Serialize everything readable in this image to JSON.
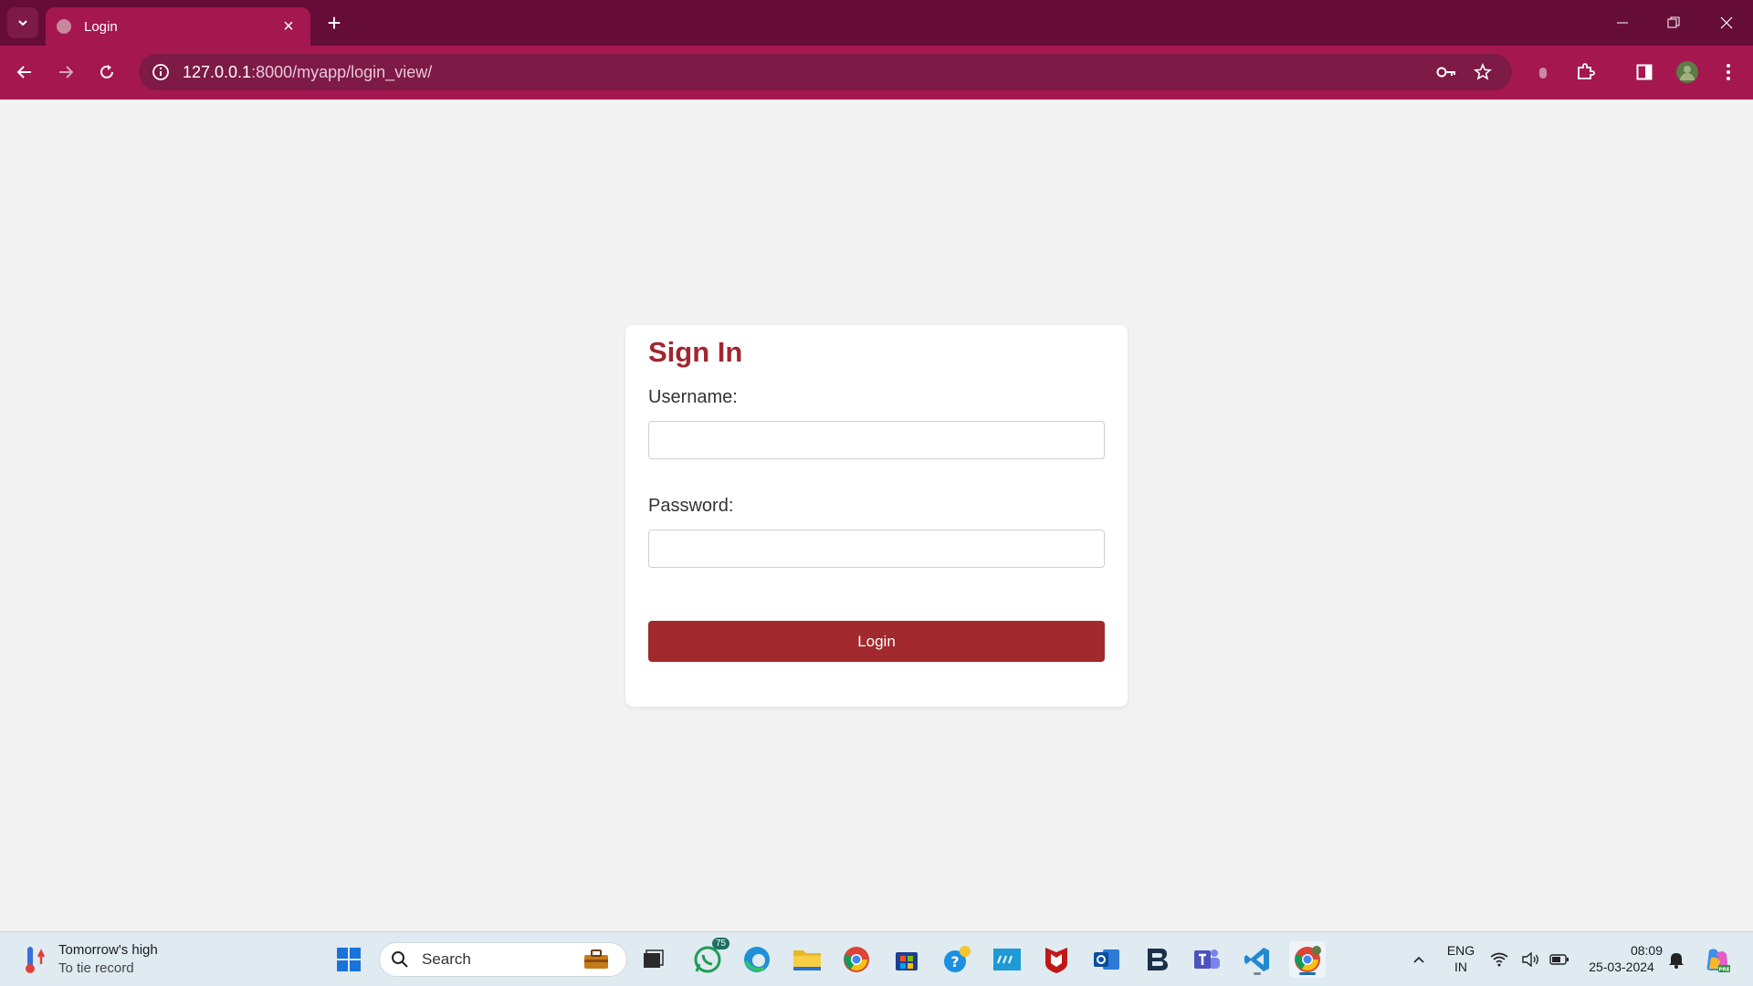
{
  "browser": {
    "tab_title": "Login",
    "url_host": "127.0.0.1",
    "url_path": ":8000/myapp/login_view/"
  },
  "login": {
    "heading": "Sign In",
    "username_label": "Username:",
    "username_value": "",
    "password_label": "Password:",
    "password_value": "",
    "button_label": "Login"
  },
  "taskbar": {
    "weather_title": "Tomorrow's high",
    "weather_subtitle": "To tie record",
    "search_placeholder": "Search",
    "whatsapp_badge": "75",
    "language_line1": "ENG",
    "language_line2": "IN",
    "time": "08:09",
    "date": "25-03-2024"
  },
  "colors": {
    "tabstrip": "#650d37",
    "toolbar": "#a5174f",
    "heading": "#a22630",
    "button": "#a2292d"
  }
}
